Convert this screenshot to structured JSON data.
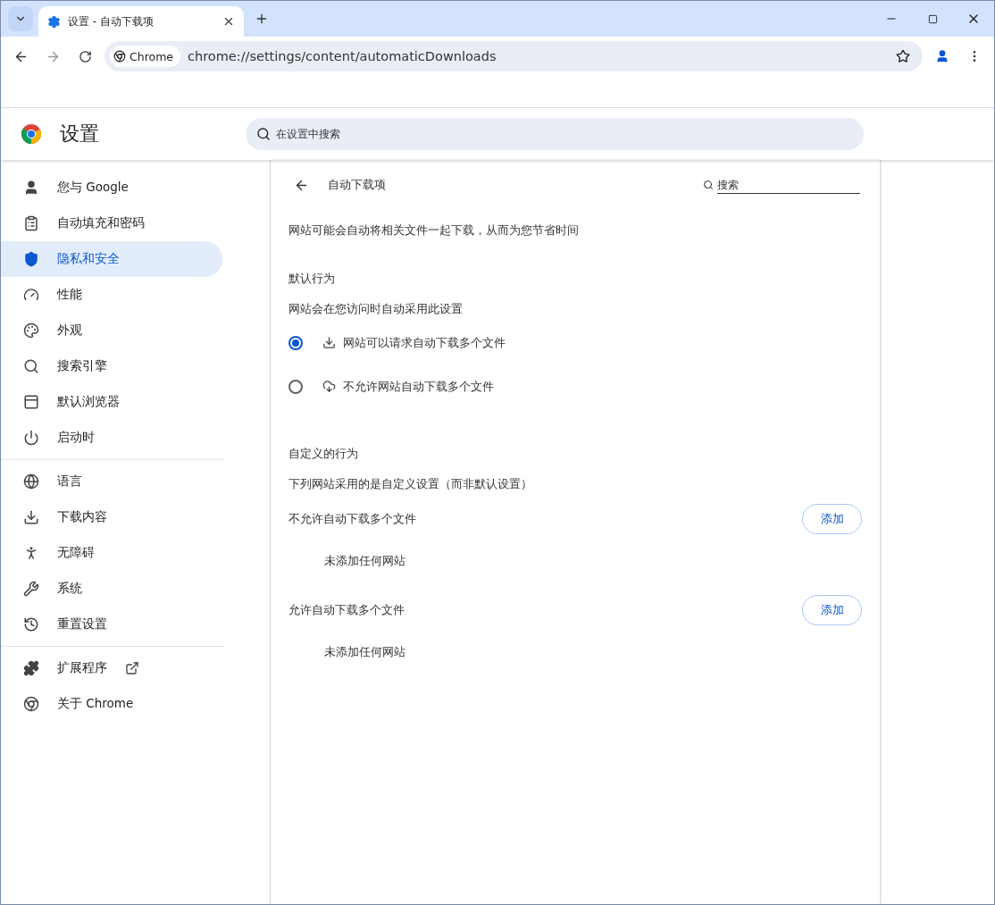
{
  "browser_tab": {
    "title": "设置 - 自动下载项",
    "selected": true
  },
  "toolbar": {
    "site_chip": "Chrome",
    "address": "chrome://settings/content/automaticDownloads"
  },
  "settings_header": {
    "title": "设置",
    "search": {
      "placeholder": "在设置中搜索"
    }
  },
  "sidebar": {
    "groups": [
      {
        "items": [
          {
            "label": "您与 Google",
            "selected": false
          },
          {
            "label": "自动填充和密码",
            "selected": false
          },
          {
            "label": "隐私和安全",
            "selected": true
          },
          {
            "label": "性能",
            "selected": false
          },
          {
            "label": "外观",
            "selected": false
          },
          {
            "label": "搜索引擎",
            "selected": false
          },
          {
            "label": "默认浏览器",
            "selected": false
          },
          {
            "label": "启动时",
            "selected": false
          }
        ]
      },
      {
        "items": [
          {
            "label": "语言",
            "selected": false
          },
          {
            "label": "下载内容",
            "selected": false
          },
          {
            "label": "无障碍",
            "selected": false
          },
          {
            "label": "系统",
            "selected": false
          },
          {
            "label": "重置设置",
            "selected": false
          }
        ]
      },
      {
        "items": [
          {
            "label": "扩展程序",
            "selected": false,
            "external_link": true
          },
          {
            "label": "关于 Chrome",
            "selected": false
          }
        ]
      }
    ]
  },
  "page": {
    "title": "自动下载项",
    "search": {
      "placeholder": "搜索"
    },
    "description": "网站可能会自动将相关文件一起下载，从而为您节省时间",
    "default_behavior": {
      "heading": "默认行为",
      "subtitle": "网站会在您访问时自动采用此设置",
      "options": [
        {
          "label": "网站可以请求自动下载多个文件",
          "selected": true
        },
        {
          "label": "不允许网站自动下载多个文件",
          "selected": false
        }
      ]
    },
    "custom_behavior": {
      "heading": "自定义的行为",
      "subtitle": "下列网站采用的是自定义设置（而非默认设置）",
      "lists": [
        {
          "title": "不允许自动下载多个文件",
          "button": "添加",
          "empty": "未添加任何网站"
        },
        {
          "title": "允许自动下载多个文件",
          "button": "添加",
          "empty": "未添加任何网站"
        }
      ]
    }
  }
}
